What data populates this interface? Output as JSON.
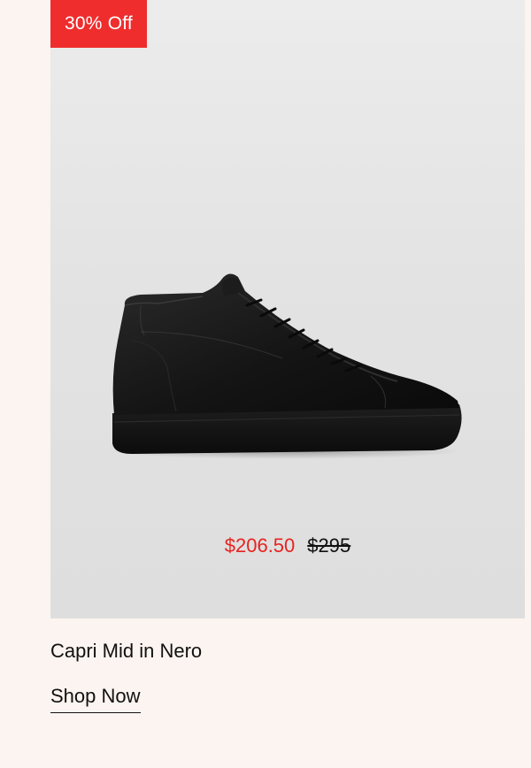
{
  "product": {
    "badge": "30% Off",
    "sale_price": "$206.50",
    "original_price": "$295",
    "title": "Capri Mid in Nero",
    "cta_label": "Shop Now",
    "image_alt": "Black leather mid-top sneaker"
  },
  "colors": {
    "page_background": "#fcf4f0",
    "card_background": "#e4e4e4",
    "badge_background": "#ef2d2d",
    "sale_price": "#e8231f",
    "text": "#111111"
  }
}
